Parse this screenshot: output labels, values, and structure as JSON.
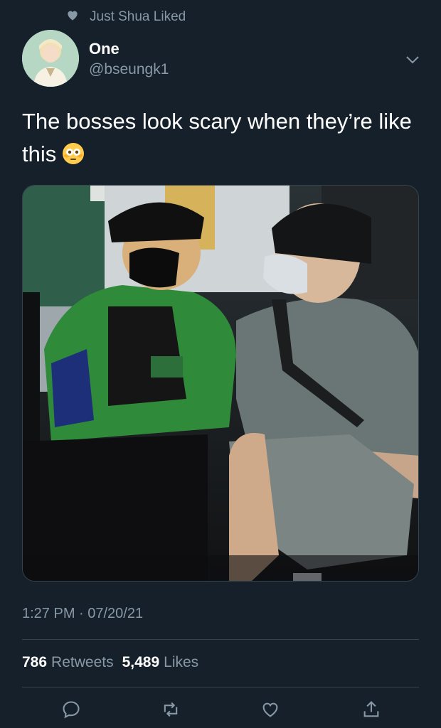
{
  "social_context": {
    "text": "Just Shua Liked",
    "icon": "heart-icon"
  },
  "author": {
    "name": "One",
    "handle": "@bseungk1"
  },
  "tweet": {
    "text": "The bosses look scary when they’re like this",
    "emoji": "flushed-face-emoji"
  },
  "media": {
    "description_icon": "photo"
  },
  "timestamp": "1:27 PM · 07/20/21",
  "stats": {
    "retweets_count": "786",
    "retweets_label": "Retweets",
    "likes_count": "5,489",
    "likes_label": "Likes"
  },
  "actions": [
    "reply-icon",
    "retweet-icon",
    "like-icon",
    "share-icon"
  ],
  "colors": {
    "background": "#15202b",
    "secondary_text": "#8899a6",
    "divider": "#38444d"
  }
}
